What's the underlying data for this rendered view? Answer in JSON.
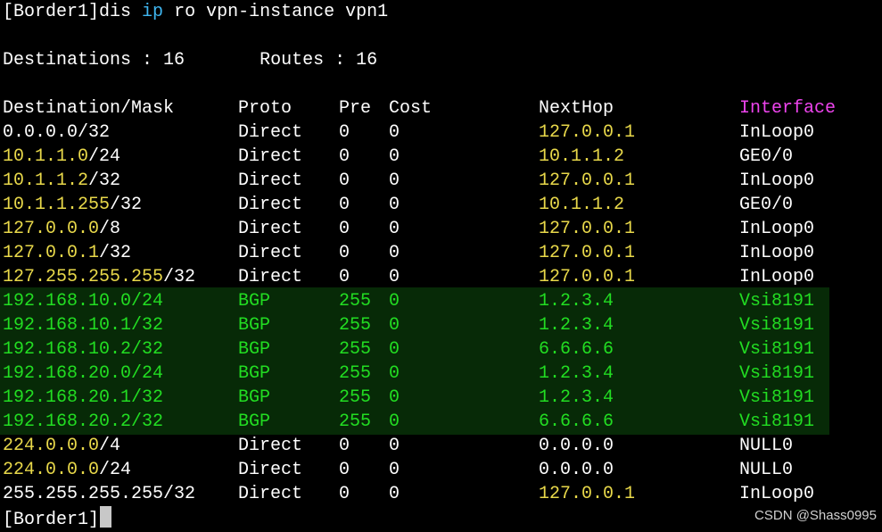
{
  "command": {
    "prompt": "[Border1]",
    "cmd_prefix": "dis ",
    "cmd_keyword": "ip",
    "cmd_suffix": " ro vpn-instance vpn1"
  },
  "summary": {
    "destinations_label": "Destinations : ",
    "destinations_value": "16",
    "routes_label": "Routes : ",
    "routes_value": "16"
  },
  "table": {
    "headers": {
      "destination": "Destination/Mask",
      "proto": "Proto",
      "pre": "Pre",
      "cost": "Cost",
      "nexthop": "NextHop",
      "interface": "Interface"
    },
    "rows": [
      {
        "dest_ip": "0.0.0.0",
        "dest_mask": "/32",
        "proto": "Direct",
        "pre": "0",
        "cost": "0",
        "nexthop": "127.0.0.1",
        "interface": "InLoop0",
        "ip_color": "white",
        "nh_color": "yellow",
        "bgp": false
      },
      {
        "dest_ip": "10.1.1.0",
        "dest_mask": "/24",
        "proto": "Direct",
        "pre": "0",
        "cost": "0",
        "nexthop": "10.1.1.2",
        "interface": "GE0/0",
        "ip_color": "yellow",
        "nh_color": "yellow",
        "bgp": false
      },
      {
        "dest_ip": "10.1.1.2",
        "dest_mask": "/32",
        "proto": "Direct",
        "pre": "0",
        "cost": "0",
        "nexthop": "127.0.0.1",
        "interface": "InLoop0",
        "ip_color": "yellow",
        "nh_color": "yellow",
        "bgp": false
      },
      {
        "dest_ip": "10.1.1.255",
        "dest_mask": "/32",
        "proto": "Direct",
        "pre": "0",
        "cost": "0",
        "nexthop": "10.1.1.2",
        "interface": "GE0/0",
        "ip_color": "yellow",
        "nh_color": "yellow",
        "bgp": false
      },
      {
        "dest_ip": "127.0.0.0",
        "dest_mask": "/8",
        "proto": "Direct",
        "pre": "0",
        "cost": "0",
        "nexthop": "127.0.0.1",
        "interface": "InLoop0",
        "ip_color": "yellow",
        "nh_color": "yellow",
        "bgp": false
      },
      {
        "dest_ip": "127.0.0.1",
        "dest_mask": "/32",
        "proto": "Direct",
        "pre": "0",
        "cost": "0",
        "nexthop": "127.0.0.1",
        "interface": "InLoop0",
        "ip_color": "yellow",
        "nh_color": "yellow",
        "bgp": false
      },
      {
        "dest_ip": "127.255.255.255",
        "dest_mask": "/32",
        "proto": "Direct",
        "pre": "0",
        "cost": "0",
        "nexthop": "127.0.0.1",
        "interface": "InLoop0",
        "ip_color": "yellow",
        "nh_color": "yellow",
        "bgp": false
      },
      {
        "dest_ip": "192.168.10.0",
        "dest_mask": "/24",
        "proto": "BGP",
        "pre": "255",
        "cost": "0",
        "nexthop": "1.2.3.4",
        "interface": "Vsi8191",
        "ip_color": "green",
        "nh_color": "green",
        "bgp": true
      },
      {
        "dest_ip": "192.168.10.1",
        "dest_mask": "/32",
        "proto": "BGP",
        "pre": "255",
        "cost": "0",
        "nexthop": "1.2.3.4",
        "interface": "Vsi8191",
        "ip_color": "green",
        "nh_color": "green",
        "bgp": true
      },
      {
        "dest_ip": "192.168.10.2",
        "dest_mask": "/32",
        "proto": "BGP",
        "pre": "255",
        "cost": "0",
        "nexthop": "6.6.6.6",
        "interface": "Vsi8191",
        "ip_color": "green",
        "nh_color": "green",
        "bgp": true
      },
      {
        "dest_ip": "192.168.20.0",
        "dest_mask": "/24",
        "proto": "BGP",
        "pre": "255",
        "cost": "0",
        "nexthop": "1.2.3.4",
        "interface": "Vsi8191",
        "ip_color": "green",
        "nh_color": "green",
        "bgp": true
      },
      {
        "dest_ip": "192.168.20.1",
        "dest_mask": "/32",
        "proto": "BGP",
        "pre": "255",
        "cost": "0",
        "nexthop": "1.2.3.4",
        "interface": "Vsi8191",
        "ip_color": "green",
        "nh_color": "green",
        "bgp": true
      },
      {
        "dest_ip": "192.168.20.2",
        "dest_mask": "/32",
        "proto": "BGP",
        "pre": "255",
        "cost": "0",
        "nexthop": "6.6.6.6",
        "interface": "Vsi8191",
        "ip_color": "green",
        "nh_color": "green",
        "bgp": true
      },
      {
        "dest_ip": "224.0.0.0",
        "dest_mask": "/4",
        "proto": "Direct",
        "pre": "0",
        "cost": "0",
        "nexthop": "0.0.0.0",
        "interface": "NULL0",
        "ip_color": "yellow",
        "nh_color": "white",
        "bgp": false
      },
      {
        "dest_ip": "224.0.0.0",
        "dest_mask": "/24",
        "proto": "Direct",
        "pre": "0",
        "cost": "0",
        "nexthop": "0.0.0.0",
        "interface": "NULL0",
        "ip_color": "yellow",
        "nh_color": "white",
        "bgp": false
      },
      {
        "dest_ip": "255.255.255.255",
        "dest_mask": "/32",
        "proto": "Direct",
        "pre": "0",
        "cost": "0",
        "nexthop": "127.0.0.1",
        "interface": "InLoop0",
        "ip_color": "white",
        "nh_color": "yellow",
        "bgp": false
      }
    ]
  },
  "final_prompt": "[Border1]",
  "watermark": "CSDN @Shass0995",
  "colors": {
    "background": "#000000",
    "text": "#ffffff",
    "keyword": "#3fb6f0",
    "yellow": "#e8d84a",
    "green": "#22dd22",
    "magenta": "#ee44ee",
    "bgp_highlight": "#072a07"
  }
}
